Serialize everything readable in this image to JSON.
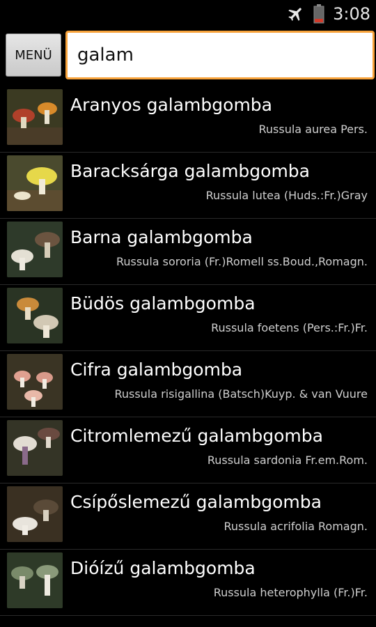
{
  "status_bar": {
    "time": "3:08",
    "icons": [
      "airplane-mode-icon",
      "battery-icon"
    ]
  },
  "toolbar": {
    "menu_label": "MENÜ",
    "search_value": "galam"
  },
  "colors": {
    "background": "#000000",
    "search_border": "#f7a23a"
  },
  "list": {
    "items": [
      {
        "common_name": "Aranyos galambgomba",
        "latin_name": "Russula aurea Pers."
      },
      {
        "common_name": "Baracksárga galambgomba",
        "latin_name": "Russula lutea (Huds.:Fr.)Gray"
      },
      {
        "common_name": "Barna galambgomba",
        "latin_name": "Russula sororia (Fr.)Romell ss.Boud.,Romagn."
      },
      {
        "common_name": "Büdös galambgomba",
        "latin_name": "Russula foetens (Pers.:Fr.)Fr."
      },
      {
        "common_name": "Cifra galambgomba",
        "latin_name": "Russula risigallina (Batsch)Kuyp. & van Vuure"
      },
      {
        "common_name": "Citromlemezű galambgomba",
        "latin_name": "Russula sardonia Fr.em.Rom."
      },
      {
        "common_name": "Csípőslemezű galambgomba",
        "latin_name": "Russula acrifolia Romagn."
      },
      {
        "common_name": "Dióízű galambgomba",
        "latin_name": "Russula heterophylla (Fr.)Fr."
      }
    ]
  }
}
